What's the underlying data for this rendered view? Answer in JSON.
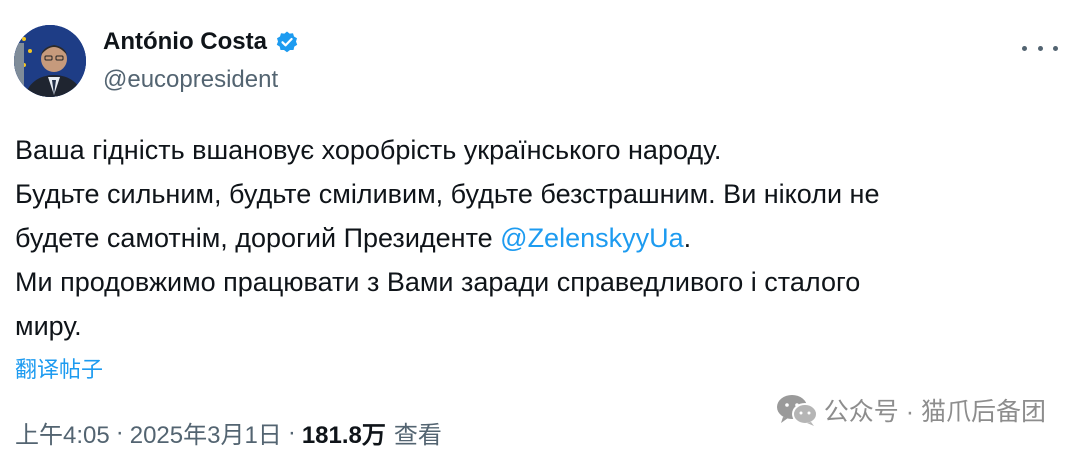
{
  "author": {
    "name": "António Costa",
    "handle": "@eucopresident",
    "verified_icon": "verified-badge-icon",
    "accent": "#1d9bf0"
  },
  "tweet": {
    "line1": "Ваша гідність вшановує хоробрість українського народу.",
    "line2": "Будьте сильним, будьте сміливим, будьте безстрашним. Ви ніколи не",
    "line3_before": "будете самотнім, дорогий Президенте ",
    "mention": "@ZelenskyyUa",
    "line3_after": ".",
    "line4": "Ми продовжимо працювати з Вами заради справедливого і сталого",
    "line5": "миру."
  },
  "translate_label": "翻译帖子",
  "meta": {
    "time": "上午4:05",
    "dot1": "·",
    "date": "2025年3月1日",
    "dot2": "·",
    "views": "181.8万",
    "views_label": "查看"
  },
  "watermark": {
    "text": "公众号 · 猫爪后备团",
    "icon": "wechat-icon"
  },
  "more_icon": "more-options-icon"
}
